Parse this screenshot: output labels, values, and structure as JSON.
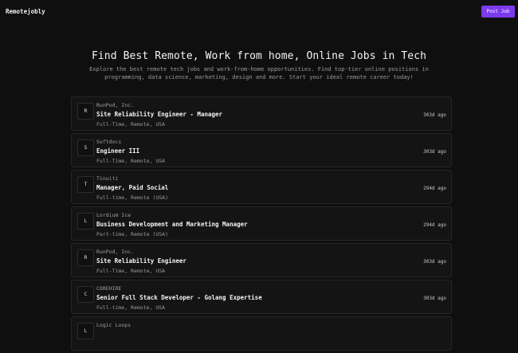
{
  "header": {
    "logo": "Remotejobly",
    "post_job_label": "Post Job"
  },
  "hero": {
    "title": "Find Best Remote, Work from home, Online Jobs in Tech",
    "subtitle": "Explore the best remote tech jobs and work-from-home opportunities. Find top-tier online positions in programming, data science, marketing, design and more. Start your ideal remote career today!"
  },
  "jobs": [
    {
      "initial": "R",
      "company": "RunPod, Inc.",
      "title": "Site Reliability Engineer - Manager",
      "meta": "Full-Time, Remote, USA",
      "posted": "303d ago"
    },
    {
      "initial": "S",
      "company": "Softdocs",
      "title": "Engineer III",
      "meta": "Full-Time, Remote, USA",
      "posted": "303d ago"
    },
    {
      "initial": "T",
      "company": "Tinuiti",
      "title": "Manager, Paid Social",
      "meta": "Full-time, Remote (USA)",
      "posted": "294d ago"
    },
    {
      "initial": "L",
      "company": "Lordium Ice",
      "title": "Business Development and Marketing Manager",
      "meta": "Part-time, Remote (USA)",
      "posted": "294d ago"
    },
    {
      "initial": "R",
      "company": "RunPod, Inc.",
      "title": "Site Reliability Engineer",
      "meta": "Full-Time, Remote, USA",
      "posted": "303d ago"
    },
    {
      "initial": "C",
      "company": "COREHIRE",
      "title": "Senior Full Stack Developer - Golang Expertise",
      "meta": "Full-time, Remote, USA",
      "posted": "303d ago"
    },
    {
      "initial": "L",
      "company": "Logic Loops",
      "title": "",
      "meta": "",
      "posted": ""
    }
  ]
}
